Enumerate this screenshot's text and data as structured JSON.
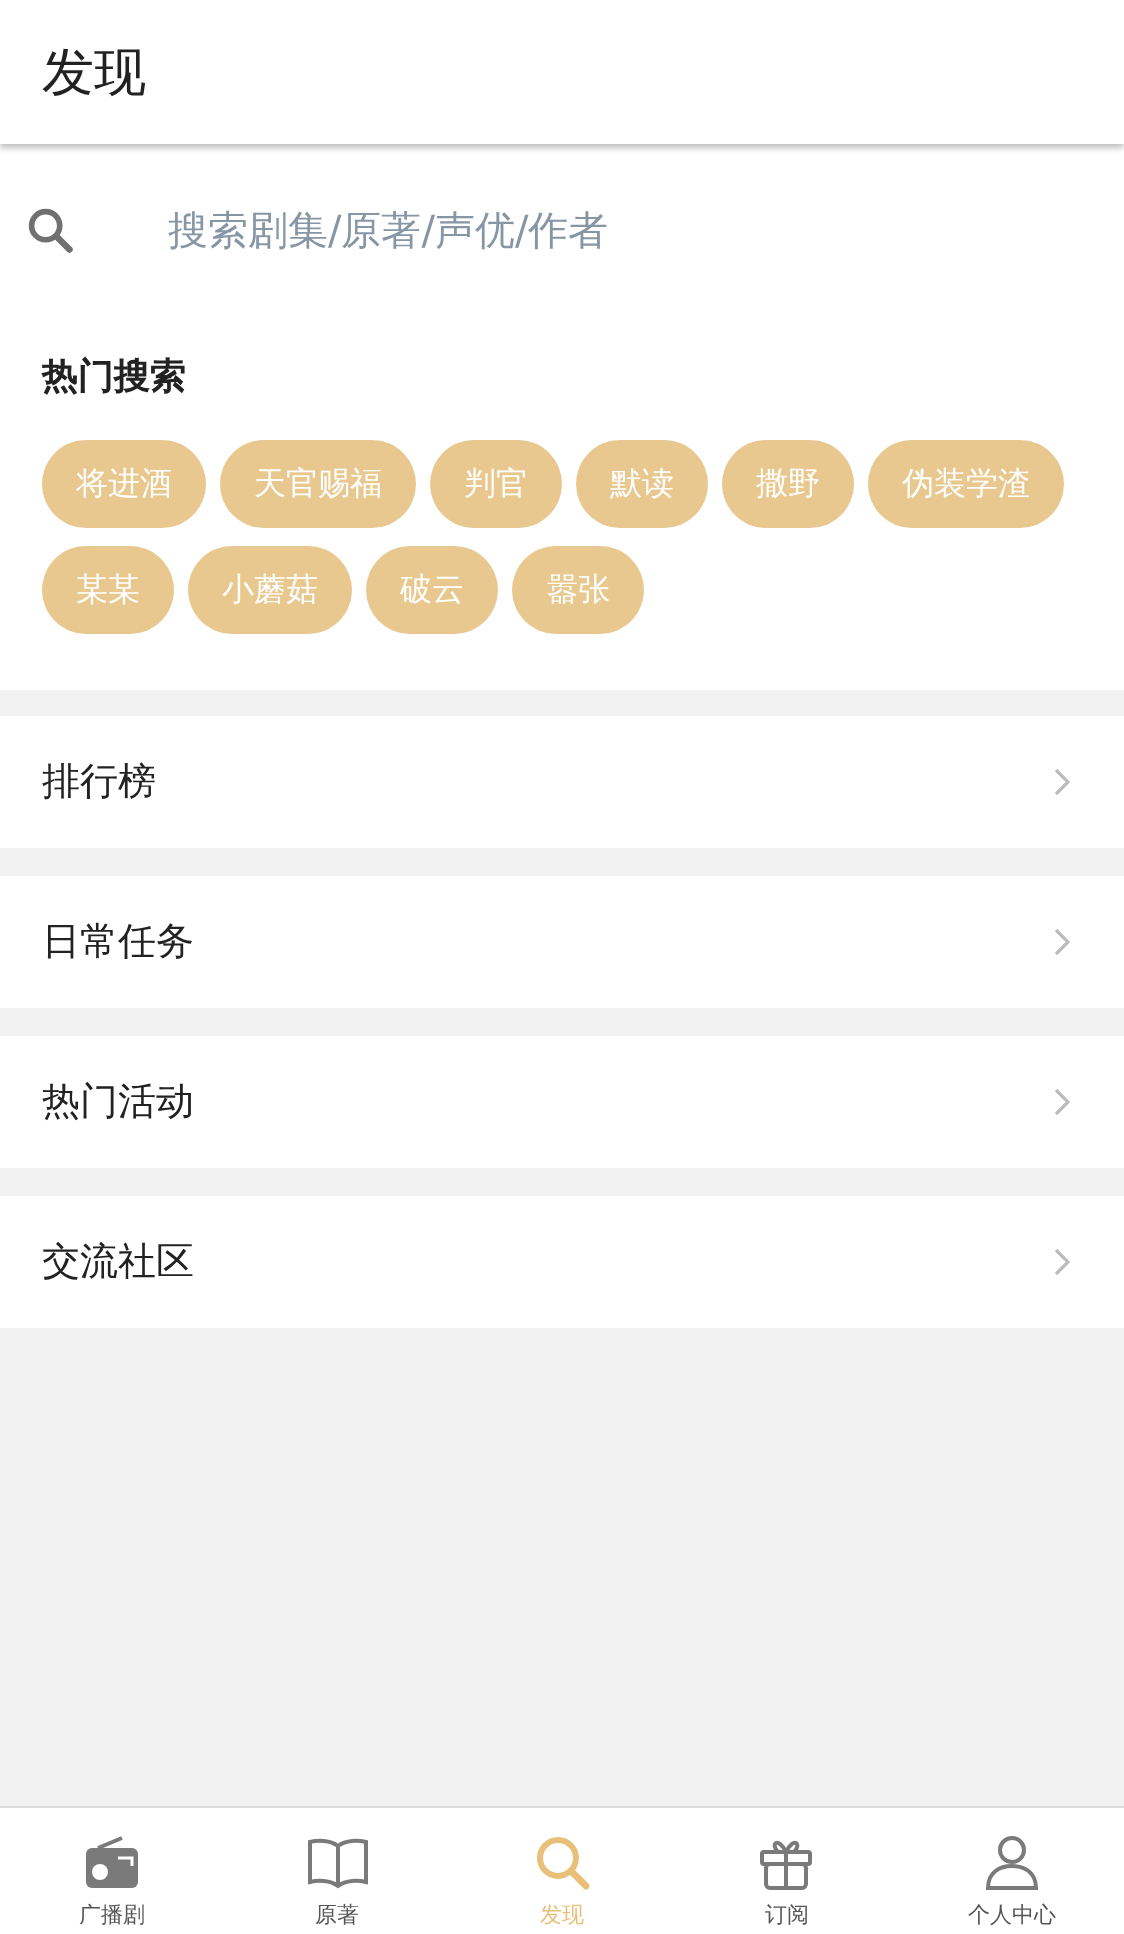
{
  "header": {
    "title": "发现"
  },
  "search": {
    "placeholder": "搜索剧集/原著/声优/作者"
  },
  "hot_search": {
    "title": "热门搜索",
    "tags": [
      "将进酒",
      "天官赐福",
      "判官",
      "默读",
      "撒野",
      "伪装学渣",
      "某某",
      "小蘑菇",
      "破云",
      "嚣张"
    ]
  },
  "menu": [
    {
      "label": "排行榜"
    },
    {
      "label": "日常任务"
    },
    {
      "label": "热门活动"
    },
    {
      "label": "交流社区"
    }
  ],
  "tab_bar": [
    {
      "label": "广播剧",
      "selected": false
    },
    {
      "label": "原著",
      "selected": false
    },
    {
      "label": "发现",
      "selected": true
    },
    {
      "label": "订阅",
      "selected": false
    },
    {
      "label": "个人中心",
      "selected": false
    }
  ]
}
